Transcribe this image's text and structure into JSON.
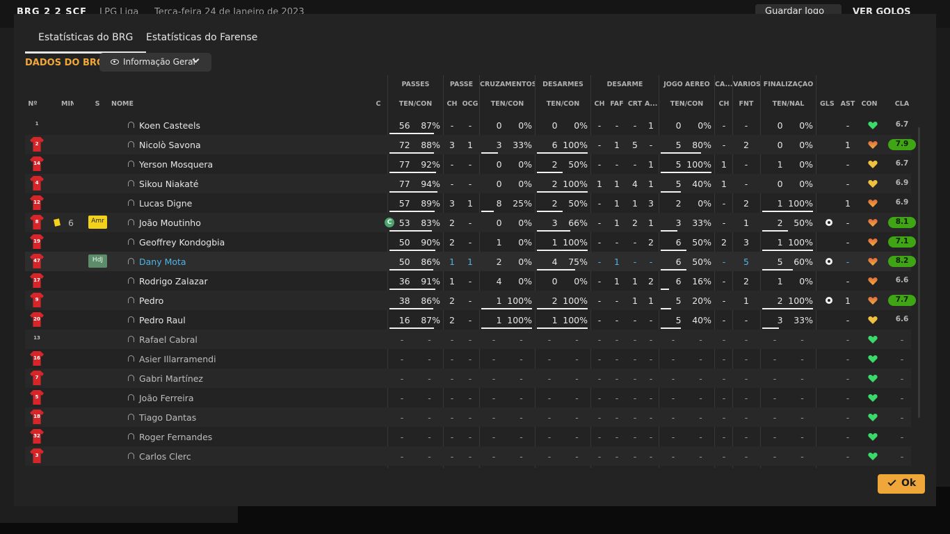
{
  "topbar": {
    "score": "BRG  2  2  SCF",
    "league": "LPG Liga",
    "date": "Terça-feira 24 de Janeiro de 2023",
    "save_label": "Guardar Jogo",
    "goals_label": "VER GOLOS"
  },
  "tabs": [
    "Estatísticas do BRG",
    "Estatísticas do Farense"
  ],
  "section_title": "DADOS DO BRG",
  "view_select": "Informação Geral",
  "group_headers": [
    "PASSES",
    "PASSE",
    "CRUZAMENTOS",
    "DESARMES",
    "DESARME",
    "JOGO AÉREO",
    "CA...",
    "VÁRIOS",
    "FINALIZAÇÃO"
  ],
  "columns": [
    "Nº",
    "MIN",
    "S",
    "NOME",
    "C",
    "TEN/CON",
    "CH",
    "OCG",
    "TEN/CON",
    "TEN/CON",
    "CH",
    "FAF",
    "CRT",
    "A...",
    "TEN/CON",
    "CH",
    "FNT",
    "TEN/NAL",
    "GLS",
    "AST",
    "CON",
    "CLA"
  ],
  "ok_label": "Ok",
  "players": [
    {
      "num": "1",
      "shirt": "gk",
      "min": "",
      "s": "",
      "name": "Koen Casteels",
      "cap": "",
      "pas": [
        "56",
        "87%"
      ],
      "pas_bar": 0.87,
      "pch": "-",
      "ocg": "-",
      "cru": [
        "0",
        "0%"
      ],
      "cru_bar": 0,
      "des": [
        "0",
        "0%"
      ],
      "des_bar": 0,
      "dch": "-",
      "faf": "-",
      "crt": "-",
      "a": "1",
      "aer": [
        "0",
        "0%"
      ],
      "aer_bar": 0,
      "ca": "-",
      "fnt": "-",
      "fin": [
        "0",
        "0%"
      ],
      "fin_bar": 0,
      "gls": "",
      "ast": "-",
      "con": "green",
      "cla": "6.7",
      "good": false
    },
    {
      "num": "2",
      "shirt": "red",
      "min": "",
      "s": "",
      "name": "Nicolò Savona",
      "cap": "",
      "pas": [
        "72",
        "88%"
      ],
      "pas_bar": 0.88,
      "pch": "3",
      "ocg": "1",
      "cru": [
        "3",
        "33%"
      ],
      "cru_bar": 0.33,
      "des": [
        "6",
        "100%"
      ],
      "des_bar": 1,
      "dch": "-",
      "faf": "1",
      "crt": "5",
      "a": "-",
      "aer": [
        "5",
        "80%"
      ],
      "aer_bar": 0.8,
      "ca": "-",
      "fnt": "2",
      "fin": [
        "0",
        "0%"
      ],
      "fin_bar": 0,
      "gls": "",
      "ast": "1",
      "con": "orange",
      "cla": "7.9",
      "good": true
    },
    {
      "num": "14",
      "shirt": "red",
      "min": "",
      "s": "",
      "name": "Yerson Mosquera",
      "cap": "",
      "pas": [
        "77",
        "92%"
      ],
      "pas_bar": 0.92,
      "pch": "-",
      "ocg": "-",
      "cru": [
        "0",
        "0%"
      ],
      "cru_bar": 0,
      "des": [
        "2",
        "50%"
      ],
      "des_bar": 0.5,
      "dch": "-",
      "faf": "-",
      "crt": "-",
      "a": "1",
      "aer": [
        "5",
        "100%"
      ],
      "aer_bar": 1,
      "ca": "1",
      "fnt": "-",
      "fin": [
        "1",
        "0%"
      ],
      "fin_bar": 0,
      "gls": "",
      "ast": "-",
      "con": "yellow",
      "cla": "6.7",
      "good": false
    },
    {
      "num": "4",
      "shirt": "red",
      "min": "",
      "s": "",
      "name": "Sikou Niakaté",
      "cap": "",
      "pas": [
        "77",
        "94%"
      ],
      "pas_bar": 0.94,
      "pch": "-",
      "ocg": "-",
      "cru": [
        "0",
        "0%"
      ],
      "cru_bar": 0,
      "des": [
        "2",
        "100%"
      ],
      "des_bar": 1,
      "dch": "1",
      "faf": "1",
      "crt": "4",
      "a": "1",
      "aer": [
        "5",
        "40%"
      ],
      "aer_bar": 0.4,
      "ca": "1",
      "fnt": "-",
      "fin": [
        "0",
        "0%"
      ],
      "fin_bar": 0,
      "gls": "",
      "ast": "-",
      "con": "yellow",
      "cla": "6.9",
      "good": false
    },
    {
      "num": "12",
      "shirt": "red",
      "min": "",
      "s": "",
      "name": "Lucas Digne",
      "cap": "",
      "pas": [
        "57",
        "89%"
      ],
      "pas_bar": 0.89,
      "pch": "3",
      "ocg": "1",
      "cru": [
        "8",
        "25%"
      ],
      "cru_bar": 0.25,
      "des": [
        "2",
        "50%"
      ],
      "des_bar": 0.5,
      "dch": "-",
      "faf": "1",
      "crt": "1",
      "a": "3",
      "aer": [
        "2",
        "0%"
      ],
      "aer_bar": 0,
      "ca": "-",
      "fnt": "2",
      "fin": [
        "1",
        "100%"
      ],
      "fin_bar": 1,
      "gls": "",
      "ast": "1",
      "con": "orange",
      "cla": "6.9",
      "good": false
    },
    {
      "num": "8",
      "shirt": "red",
      "min": "6",
      "s": "Amr",
      "name": "João Moutinho",
      "cap": "C",
      "pas": [
        "53",
        "83%"
      ],
      "pas_bar": 0.83,
      "pch": "2",
      "ocg": "-",
      "cru": [
        "0",
        "0%"
      ],
      "cru_bar": 0,
      "des": [
        "3",
        "66%"
      ],
      "des_bar": 0.66,
      "dch": "-",
      "faf": "1",
      "crt": "2",
      "a": "1",
      "aer": [
        "3",
        "33%"
      ],
      "aer_bar": 0.33,
      "ca": "-",
      "fnt": "1",
      "fin": [
        "2",
        "50%"
      ],
      "fin_bar": 0.5,
      "gls": "ball",
      "ast": "-",
      "con": "orange",
      "cla": "8.1",
      "good": true
    },
    {
      "num": "19",
      "shirt": "red",
      "min": "",
      "s": "",
      "name": "Geoffrey Kondogbia",
      "cap": "",
      "pas": [
        "50",
        "90%"
      ],
      "pas_bar": 0.9,
      "pch": "2",
      "ocg": "-",
      "cru": [
        "1",
        "0%"
      ],
      "cru_bar": 0,
      "des": [
        "1",
        "100%"
      ],
      "des_bar": 1,
      "dch": "-",
      "faf": "-",
      "crt": "-",
      "a": "2",
      "aer": [
        "6",
        "50%"
      ],
      "aer_bar": 0.5,
      "ca": "2",
      "fnt": "3",
      "fin": [
        "1",
        "100%"
      ],
      "fin_bar": 1,
      "gls": "",
      "ast": "-",
      "con": "orange",
      "cla": "7.1",
      "good": true
    },
    {
      "num": "47",
      "shirt": "red",
      "min": "",
      "s": "HdJ",
      "name": "Dany Mota",
      "cap": "",
      "pas": [
        "50",
        "86%"
      ],
      "pas_bar": 0.86,
      "pch": "1",
      "ocg": "1",
      "cru": [
        "2",
        "0%"
      ],
      "cru_bar": 0,
      "des": [
        "4",
        "75%"
      ],
      "des_bar": 0.75,
      "dch": "-",
      "faf": "1",
      "crt": "-",
      "a": "-",
      "aer": [
        "6",
        "50%"
      ],
      "aer_bar": 0.5,
      "ca": "-",
      "fnt": "5",
      "fin": [
        "5",
        "60%"
      ],
      "fin_bar": 0.6,
      "gls": "ball",
      "ast": "-",
      "con": "orange",
      "cla": "8.2",
      "good": true,
      "highlight": true
    },
    {
      "num": "17",
      "shirt": "red",
      "min": "",
      "s": "",
      "name": "Rodrigo Zalazar",
      "cap": "",
      "pas": [
        "36",
        "91%"
      ],
      "pas_bar": 0.91,
      "pch": "1",
      "ocg": "-",
      "cru": [
        "4",
        "0%"
      ],
      "cru_bar": 0,
      "des": [
        "0",
        "0%"
      ],
      "des_bar": 0,
      "dch": "-",
      "faf": "1",
      "crt": "1",
      "a": "2",
      "aer": [
        "6",
        "16%"
      ],
      "aer_bar": 0.16,
      "ca": "-",
      "fnt": "2",
      "fin": [
        "1",
        "0%"
      ],
      "fin_bar": 0,
      "gls": "",
      "ast": "-",
      "con": "orange",
      "cla": "6.6",
      "good": false
    },
    {
      "num": "9",
      "shirt": "red",
      "min": "",
      "s": "",
      "name": "Pedro",
      "cap": "",
      "pas": [
        "38",
        "86%"
      ],
      "pas_bar": 0.86,
      "pch": "2",
      "ocg": "-",
      "cru": [
        "1",
        "100%"
      ],
      "cru_bar": 1,
      "des": [
        "2",
        "100%"
      ],
      "des_bar": 1,
      "dch": "-",
      "faf": "-",
      "crt": "1",
      "a": "1",
      "aer": [
        "5",
        "20%"
      ],
      "aer_bar": 0.2,
      "ca": "-",
      "fnt": "1",
      "fin": [
        "2",
        "100%"
      ],
      "fin_bar": 1,
      "gls": "ball",
      "ast": "1",
      "con": "orange",
      "cla": "7.7",
      "good": true
    },
    {
      "num": "20",
      "shirt": "red",
      "min": "",
      "s": "",
      "name": "Pedro Raul",
      "cap": "",
      "pas": [
        "16",
        "87%"
      ],
      "pas_bar": 0.87,
      "pch": "2",
      "ocg": "-",
      "cru": [
        "1",
        "100%"
      ],
      "cru_bar": 1,
      "des": [
        "1",
        "100%"
      ],
      "des_bar": 1,
      "dch": "-",
      "faf": "-",
      "crt": "-",
      "a": "-",
      "aer": [
        "5",
        "40%"
      ],
      "aer_bar": 0.4,
      "ca": "-",
      "fnt": "-",
      "fin": [
        "3",
        "33%"
      ],
      "fin_bar": 0.33,
      "gls": "",
      "ast": "-",
      "con": "yellow",
      "cla": "6.6",
      "good": false
    },
    {
      "num": "13",
      "shirt": "gk",
      "sub": true,
      "name": "Rafael Cabral"
    },
    {
      "num": "16",
      "shirt": "red",
      "sub": true,
      "name": "Asier Illarramendi"
    },
    {
      "num": "7",
      "shirt": "red",
      "sub": true,
      "name": "Gabri Martínez"
    },
    {
      "num": "5",
      "shirt": "red",
      "sub": true,
      "name": "João Ferreira"
    },
    {
      "num": "18",
      "shirt": "red",
      "sub": true,
      "name": "Tiago Dantas"
    },
    {
      "num": "32",
      "shirt": "red",
      "sub": true,
      "name": "Roger Fernandes"
    },
    {
      "num": "3",
      "shirt": "red",
      "sub": true,
      "name": "Carlos Clerc"
    }
  ]
}
